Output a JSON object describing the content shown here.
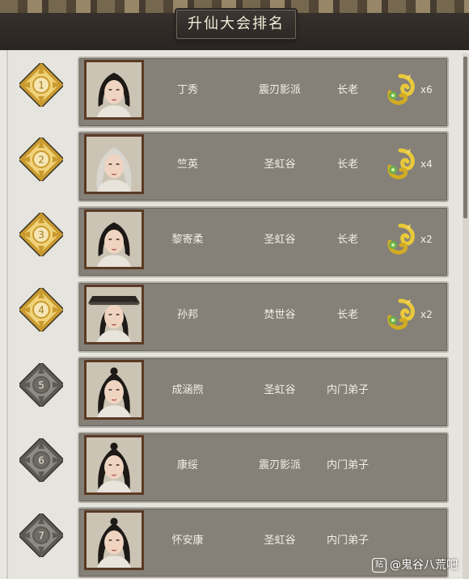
{
  "title": "升仙大会排名",
  "rows": [
    {
      "rank": "1",
      "name": "丁秀",
      "sect": "震刃影派",
      "role": "长老",
      "reward_qty": "x6",
      "medal": "gold",
      "hair": "black-short"
    },
    {
      "rank": "2",
      "name": "竺英",
      "sect": "圣虹谷",
      "role": "长老",
      "reward_qty": "x4",
      "medal": "gold",
      "hair": "silver"
    },
    {
      "rank": "3",
      "name": "黎寄柔",
      "sect": "圣虹谷",
      "role": "长老",
      "reward_qty": "x2",
      "medal": "gold",
      "hair": "black-long"
    },
    {
      "rank": "4",
      "name": "孙邦",
      "sect": "焚世谷",
      "role": "长老",
      "reward_qty": "x2",
      "medal": "gold",
      "hair": "hat"
    },
    {
      "rank": "5",
      "name": "成涵煦",
      "sect": "圣虹谷",
      "role": "内门弟子",
      "reward_qty": "",
      "medal": "silver",
      "hair": "black-tied"
    },
    {
      "rank": "6",
      "name": "康绥",
      "sect": "震刃影派",
      "role": "内门弟子",
      "reward_qty": "",
      "medal": "silver",
      "hair": "black-tied"
    },
    {
      "rank": "7",
      "name": "怀安康",
      "sect": "圣虹谷",
      "role": "内门弟子",
      "reward_qty": "",
      "medal": "silver",
      "hair": "black-tied"
    }
  ],
  "watermark": {
    "badge": "贴",
    "text": "@鬼谷八荒吧"
  },
  "colors": {
    "card": "#858078",
    "gold": "#d9b44a",
    "silver": "#8c8882",
    "portrait_frame": "#5a3a24"
  }
}
